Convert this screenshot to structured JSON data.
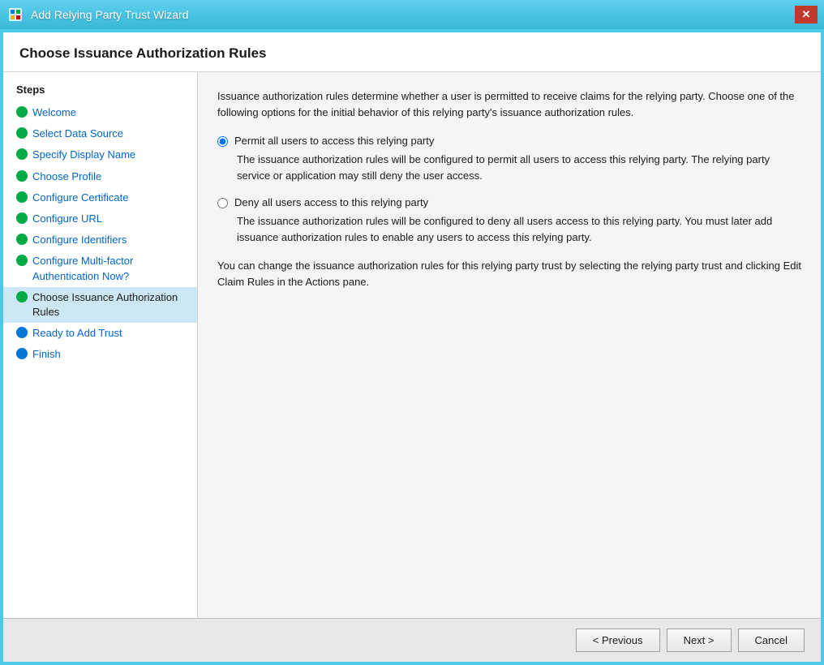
{
  "window": {
    "title": "Add Relying Party Trust Wizard",
    "close_button": "✕"
  },
  "page_heading": "Choose Issuance Authorization Rules",
  "sidebar": {
    "heading": "Steps",
    "items": [
      {
        "id": "welcome",
        "label": "Welcome",
        "dot_type": "green",
        "active": false
      },
      {
        "id": "select-data-source",
        "label": "Select Data Source",
        "dot_type": "green",
        "active": false
      },
      {
        "id": "specify-display-name",
        "label": "Specify Display Name",
        "dot_type": "green",
        "active": false
      },
      {
        "id": "choose-profile",
        "label": "Choose Profile",
        "dot_type": "green",
        "active": false
      },
      {
        "id": "configure-certificate",
        "label": "Configure Certificate",
        "dot_type": "green",
        "active": false
      },
      {
        "id": "configure-url",
        "label": "Configure URL",
        "dot_type": "green",
        "active": false
      },
      {
        "id": "configure-identifiers",
        "label": "Configure Identifiers",
        "dot_type": "green",
        "active": false
      },
      {
        "id": "configure-multifactor",
        "label": "Configure Multi-factor Authentication Now?",
        "dot_type": "green",
        "active": false
      },
      {
        "id": "choose-issuance",
        "label": "Choose Issuance Authorization Rules",
        "dot_type": "green",
        "active": true
      },
      {
        "id": "ready-to-add",
        "label": "Ready to Add Trust",
        "dot_type": "blue",
        "active": false
      },
      {
        "id": "finish",
        "label": "Finish",
        "dot_type": "blue",
        "active": false
      }
    ]
  },
  "main": {
    "description": "Issuance authorization rules determine whether a user is permitted to receive claims for the relying party. Choose one of the following options for the initial behavior of this relying party's issuance authorization rules.",
    "options": [
      {
        "id": "permit-all",
        "label": "Permit all users to access this relying party",
        "description": "The issuance authorization rules will be configured to permit all users to access this relying party. The relying party service or application may still deny the user access.",
        "selected": true
      },
      {
        "id": "deny-all",
        "label": "Deny all users access to this relying party",
        "description": "The issuance authorization rules will be configured to deny all users access to this relying party. You must later add issuance authorization rules to enable any users to access this relying party.",
        "selected": false
      }
    ],
    "footer_note": "You can change the issuance authorization rules for this relying party trust by selecting the relying party trust and clicking Edit Claim Rules in the Actions pane."
  },
  "buttons": {
    "previous": "< Previous",
    "next": "Next >",
    "cancel": "Cancel"
  }
}
